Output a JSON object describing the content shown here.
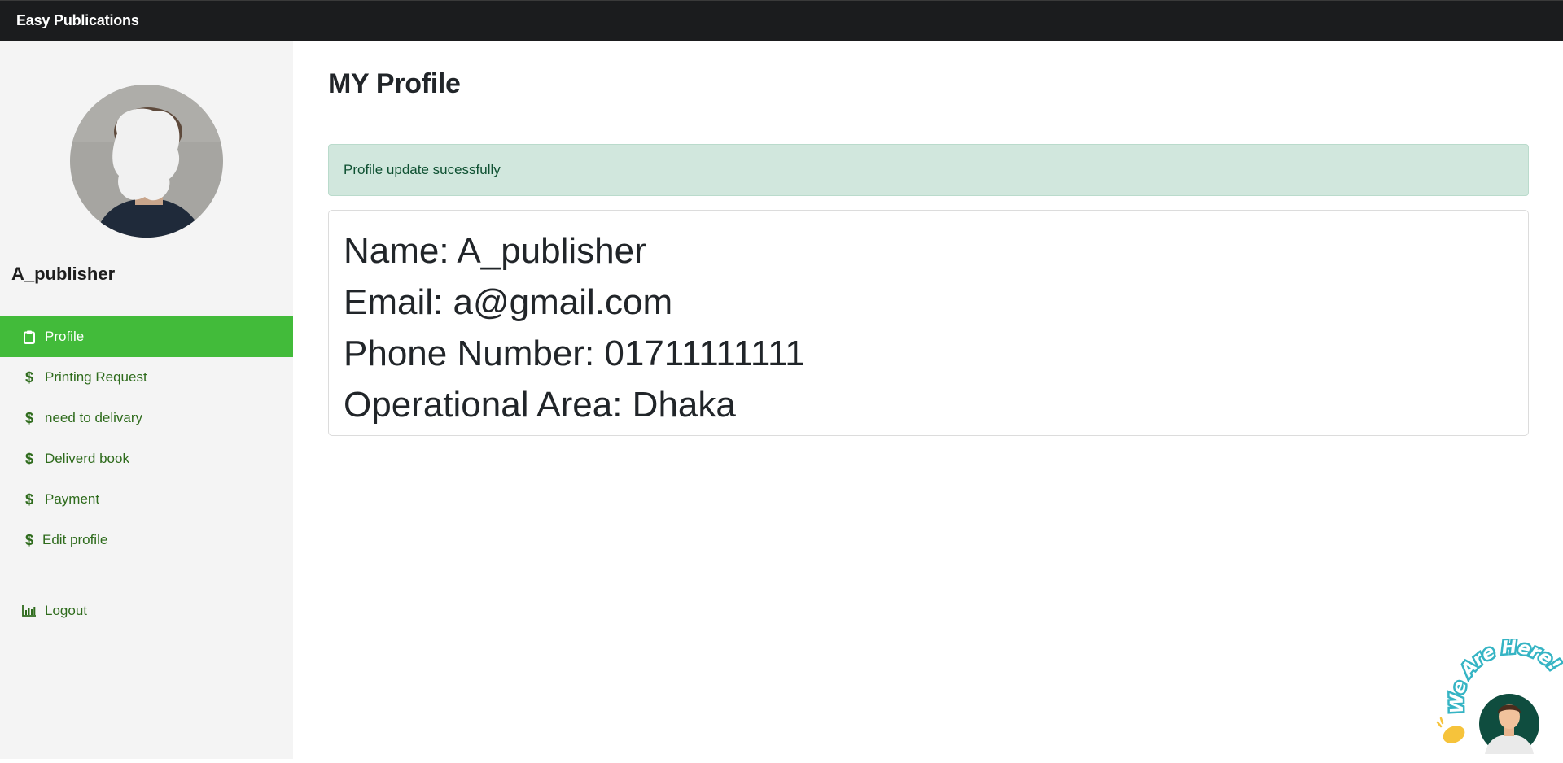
{
  "app": {
    "brand": "Easy Publications"
  },
  "sidebar": {
    "user_name": "A_publisher",
    "items": [
      {
        "label": "Profile",
        "icon": "clipboard-icon",
        "active": true
      },
      {
        "label": "Printing Request",
        "icon": "dollar-icon"
      },
      {
        "label": "need to delivary",
        "icon": "dollar-icon"
      },
      {
        "label": "Deliverd book",
        "icon": "dollar-icon"
      },
      {
        "label": "Payment",
        "icon": "dollar-icon"
      },
      {
        "label": "Edit profile",
        "icon": "dollar-icon"
      },
      {
        "label": "Logout",
        "icon": "bar-chart-icon"
      }
    ]
  },
  "main": {
    "title": "MY Profile",
    "alert": "Profile update sucessfully",
    "profile": {
      "name_line": "Name: A_publisher",
      "email_line": "Email: a@gmail.com",
      "phone_line": "Phone Number: 01711111111",
      "area_line": "Operational Area: Dhaka"
    }
  },
  "chat_widget": {
    "text": "We Are Here!",
    "icon": "waving-hand-icon"
  },
  "colors": {
    "navbar": "#1b1c1e",
    "sidebar_bg": "#f4f4f4",
    "active_item": "#42bb3a",
    "link_green": "#2e6b1c",
    "alert_bg": "#d1e7dd",
    "alert_text": "#0f5132",
    "widget_teal": "#35b4c4"
  }
}
